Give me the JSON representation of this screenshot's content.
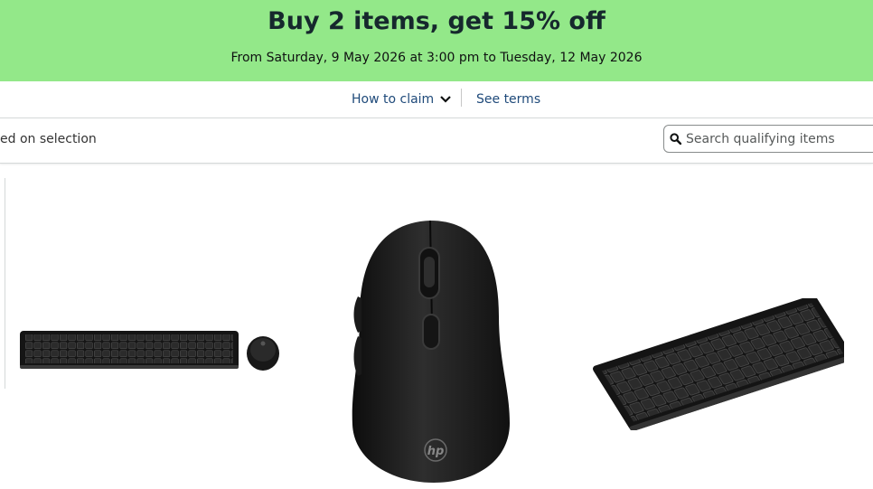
{
  "banner": {
    "title": "Buy 2 items, get 15% off",
    "subtitle": "From Saturday, 9 May 2026 at 3:00 pm to Tuesday, 12 May 2026",
    "background_color": "#93e889"
  },
  "claim": {
    "how_to_claim_label": "How to claim",
    "see_terms_label": "See terms",
    "link_color": "#1f4a7a"
  },
  "filter": {
    "text": "ed on selection",
    "search_placeholder": "Search qualifying items",
    "search_icon": "search-icon"
  },
  "products": [
    {
      "kind": "keyboard-and-mouse-combo"
    },
    {
      "kind": "wireless-mouse",
      "logo_text": "hp"
    },
    {
      "kind": "compact-keyboard"
    }
  ]
}
